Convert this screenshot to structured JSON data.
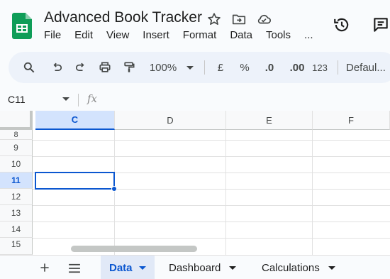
{
  "app": {
    "title": "Advanced Book Tracker",
    "menu": [
      "File",
      "Edit",
      "View",
      "Insert",
      "Format",
      "Data",
      "Tools",
      "..."
    ],
    "brand_color": "#0f9d58",
    "accent_color": "#0b57d0"
  },
  "toolbar": {
    "zoom": "100%",
    "currency": "£",
    "percent": "%",
    "decrease_decimal": ".0",
    "increase_decimal": ".00",
    "number_format": "123",
    "font": "Defaul..."
  },
  "formula_bar": {
    "name_box": "C11",
    "fx_label": "fx",
    "formula": ""
  },
  "grid": {
    "columns": [
      "C",
      "D",
      "E",
      "F"
    ],
    "rows": [
      "8",
      "9",
      "10",
      "11",
      "12",
      "13",
      "14",
      "15"
    ],
    "selected_cell": "C11",
    "selected_column": "C",
    "selected_row": "11"
  },
  "sheets": {
    "tabs": [
      {
        "label": "Data",
        "active": true
      },
      {
        "label": "Dashboard",
        "active": false
      },
      {
        "label": "Calculations",
        "active": false
      }
    ]
  }
}
